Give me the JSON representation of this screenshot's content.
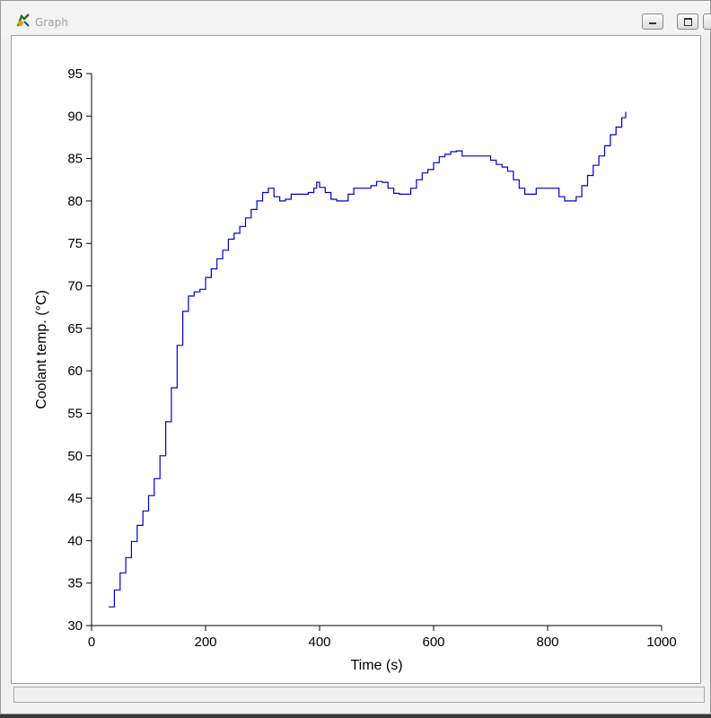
{
  "window": {
    "title": "Graph",
    "icon": "app-graph-icon",
    "controls": [
      "minimize",
      "maximize",
      "close"
    ]
  },
  "chart_data": {
    "type": "line",
    "title": "",
    "xlabel": "Time (s)",
    "ylabel": "Coolant temp. (°C)",
    "xlim": [
      0,
      1000
    ],
    "ylim": [
      30,
      95
    ],
    "xticks": [
      0,
      200,
      400,
      600,
      800,
      1000
    ],
    "yticks": [
      30,
      35,
      40,
      45,
      50,
      55,
      60,
      65,
      70,
      75,
      80,
      85,
      90,
      95
    ],
    "grid": false,
    "line_color": "#0000cc",
    "series": [
      {
        "values": [
          [
            30,
            32.2
          ],
          [
            40,
            34.2
          ],
          [
            50,
            36.2
          ],
          [
            60,
            38.0
          ],
          [
            70,
            39.9
          ],
          [
            80,
            41.8
          ],
          [
            90,
            43.5
          ],
          [
            100,
            45.3
          ],
          [
            110,
            47.3
          ],
          [
            120,
            50.0
          ],
          [
            130,
            54.0
          ],
          [
            140,
            58.0
          ],
          [
            150,
            63.0
          ],
          [
            160,
            67.0
          ],
          [
            170,
            68.8
          ],
          [
            180,
            69.3
          ],
          [
            190,
            69.6
          ],
          [
            200,
            71.0
          ],
          [
            210,
            72.0
          ],
          [
            220,
            73.2
          ],
          [
            230,
            74.2
          ],
          [
            240,
            75.5
          ],
          [
            250,
            76.2
          ],
          [
            260,
            77.0
          ],
          [
            270,
            78.0
          ],
          [
            280,
            79.0
          ],
          [
            290,
            80.0
          ],
          [
            300,
            81.0
          ],
          [
            310,
            81.5
          ],
          [
            320,
            80.5
          ],
          [
            330,
            80.0
          ],
          [
            340,
            80.2
          ],
          [
            350,
            80.8
          ],
          [
            360,
            80.8
          ],
          [
            370,
            80.8
          ],
          [
            380,
            81.0
          ],
          [
            390,
            81.5
          ],
          [
            395,
            82.2
          ],
          [
            400,
            81.6
          ],
          [
            410,
            81.0
          ],
          [
            420,
            80.2
          ],
          [
            430,
            80.0
          ],
          [
            440,
            80.0
          ],
          [
            450,
            80.8
          ],
          [
            460,
            81.5
          ],
          [
            470,
            81.5
          ],
          [
            480,
            81.5
          ],
          [
            490,
            81.8
          ],
          [
            500,
            82.3
          ],
          [
            510,
            82.2
          ],
          [
            520,
            81.5
          ],
          [
            530,
            80.9
          ],
          [
            540,
            80.8
          ],
          [
            550,
            80.8
          ],
          [
            560,
            81.5
          ],
          [
            570,
            82.5
          ],
          [
            580,
            83.3
          ],
          [
            590,
            83.7
          ],
          [
            600,
            84.5
          ],
          [
            610,
            85.2
          ],
          [
            620,
            85.5
          ],
          [
            630,
            85.8
          ],
          [
            640,
            85.9
          ],
          [
            650,
            85.3
          ],
          [
            660,
            85.3
          ],
          [
            670,
            85.3
          ],
          [
            680,
            85.3
          ],
          [
            690,
            85.3
          ],
          [
            700,
            84.8
          ],
          [
            710,
            84.3
          ],
          [
            720,
            84.0
          ],
          [
            730,
            83.5
          ],
          [
            740,
            82.5
          ],
          [
            750,
            81.5
          ],
          [
            760,
            80.8
          ],
          [
            770,
            80.8
          ],
          [
            780,
            81.5
          ],
          [
            790,
            81.5
          ],
          [
            800,
            81.5
          ],
          [
            810,
            81.5
          ],
          [
            820,
            80.5
          ],
          [
            830,
            80.0
          ],
          [
            840,
            80.0
          ],
          [
            850,
            80.5
          ],
          [
            860,
            81.8
          ],
          [
            870,
            83.0
          ],
          [
            880,
            84.2
          ],
          [
            890,
            85.3
          ],
          [
            900,
            86.5
          ],
          [
            910,
            87.8
          ],
          [
            920,
            88.7
          ],
          [
            930,
            89.8
          ],
          [
            937,
            90.5
          ]
        ]
      }
    ]
  }
}
